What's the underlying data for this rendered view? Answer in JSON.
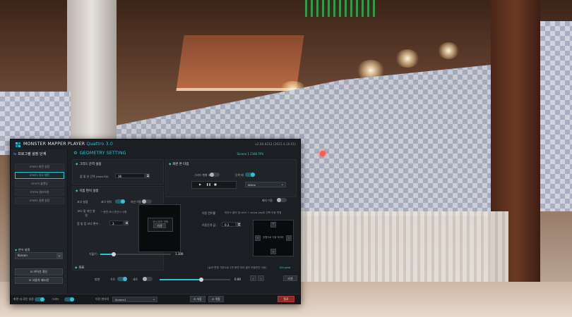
{
  "window": {
    "app_name": "MONSTER MAPPER PLAYER",
    "edition": "Quattro 3.0",
    "version": "v2.00.0212 (2021.4.16.01)"
  },
  "sidebar": {
    "title": "프로그램 설정 단계",
    "steps": [
      {
        "label": "STEP1 화면 설정",
        "active": false
      },
      {
        "label": "STEP2 지오 메트",
        "active": true
      },
      {
        "label": "STEP3 블렌딩",
        "active": false
      },
      {
        "label": "STEP4 컬러보정",
        "active": false
      },
      {
        "label": "STEP5 실행 설정",
        "active": false
      }
    ],
    "language_label": "언어 설정",
    "language_value": "Korean",
    "buttons": {
      "activation": "라이선 갱신",
      "manual": "사용자 매뉴얼"
    }
  },
  "main": {
    "title": "GEOMETRY SETTING",
    "resolution_info": "Screen 1 2160 FPS",
    "grid_section": {
      "title": "그리드 간격 설정",
      "label": "점 및 선 간격 (max:50)",
      "value": "36"
    },
    "screen_type_section": {
      "title": "화면 톤 타입",
      "toggle_grid_label": "그리드 변화 표",
      "toggle_color_label": "단색 배",
      "color_value": "White"
    },
    "edit_section": {
      "title": "지폼 편석 설정",
      "corner_label": "코너 설정",
      "toggle_corner": "코너 위치",
      "toggle_line": "라인 이동",
      "toggle_curve": "베지 이동",
      "subgroup_label": "코너 및 라인 설정",
      "subgroup_hint": "• 평면 코너 편선시 사용",
      "points_label": "점 및 점 코너 편수 :",
      "points_value": "3",
      "preview_label": "코너 위치 선택",
      "preview_button": "리셋",
      "gamma_label": "기울기 :",
      "gamma_value": "1.300",
      "move_label": "이동 컨트롤",
      "move_hint": "마우스 클릭 및 shift + arrow key로 선택 이동 변경",
      "step_label": "이동간격 값 :",
      "step_value": "0.3",
      "arrow_center": "방향으로 이동 하여라"
    },
    "offset_section": {
      "title": "좌표",
      "hint": "(슬라 변형 기준으로 2번 화면 부터 결리 허용만인 이동)",
      "right_hint": "0/0 pixel",
      "row_label": "방향",
      "toggle_a": "가로",
      "toggle_b": "세로",
      "value": "0.00",
      "reset": "리셋"
    }
  },
  "bottombar": {
    "toggle_label": "화면 내 루틴 설정",
    "toggle2_label": "그리드",
    "select_label": "이전 편의적",
    "select_value": "Screen1",
    "btn_save": "저장",
    "btn_load": "적용",
    "btn_close": "종료"
  },
  "colors": {
    "accent": "#2ec4d6",
    "panel_bg": "#1b1e22",
    "close": "#8a2a2a"
  }
}
